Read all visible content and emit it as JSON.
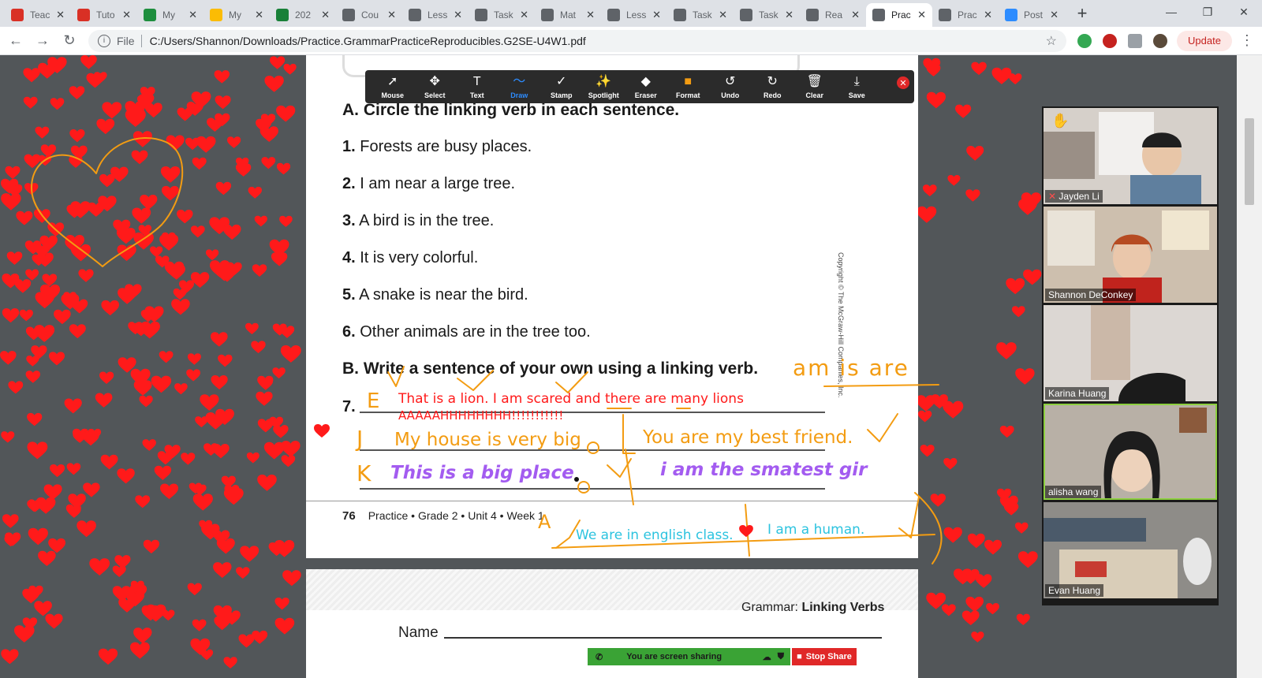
{
  "browser": {
    "tabs": [
      {
        "label": "Teac",
        "icon": "red-i-icon",
        "color": "#d93025"
      },
      {
        "label": "Tuto",
        "icon": "red-i-icon",
        "color": "#d93025"
      },
      {
        "label": "My",
        "icon": "drive-icon",
        "color": "#1e8e3e"
      },
      {
        "label": "My",
        "icon": "drive-icon",
        "color": "#fbbc04"
      },
      {
        "label": "202",
        "icon": "sheets-plus-icon",
        "color": "#188038"
      },
      {
        "label": "Cou",
        "icon": "doc-icon",
        "color": "#5f6368"
      },
      {
        "label": "Less",
        "icon": "doc-icon",
        "color": "#5f6368"
      },
      {
        "label": "Task",
        "icon": "doc-icon",
        "color": "#5f6368"
      },
      {
        "label": "Mat",
        "icon": "globe-icon",
        "color": "#5f6368"
      },
      {
        "label": "Less",
        "icon": "doc-icon",
        "color": "#5f6368"
      },
      {
        "label": "Task",
        "icon": "doc-icon",
        "color": "#5f6368"
      },
      {
        "label": "Task",
        "icon": "doc-icon",
        "color": "#5f6368"
      },
      {
        "label": "Rea",
        "icon": "globe-icon",
        "color": "#5f6368"
      },
      {
        "label": "Prac",
        "icon": "globe-icon",
        "color": "#5f6368",
        "active": true
      },
      {
        "label": "Prac",
        "icon": "globe-icon",
        "color": "#5f6368"
      },
      {
        "label": "Post",
        "icon": "zoom-icon",
        "color": "#2d8cff"
      }
    ],
    "scheme": "File",
    "url": "C:/Users/Shannon/Downloads/Practice.GrammarPracticeReproducibles.G2SE-U4W1.pdf",
    "update_label": "Update"
  },
  "worksheet": {
    "heading_a": "A. Circle the linking verb in each sentence.",
    "items": [
      {
        "num": "1.",
        "text": "Forests are busy places."
      },
      {
        "num": "2.",
        "text": "I am near a large tree."
      },
      {
        "num": "3.",
        "text": "A bird is in the tree."
      },
      {
        "num": "4.",
        "text": "It is very colorful."
      },
      {
        "num": "5.",
        "text": "A snake is near the bird."
      },
      {
        "num": "6.",
        "text": "Other animals are in the tree too."
      }
    ],
    "heading_b": "B. Write a sentence of your own using a linking verb.",
    "item7": "7.",
    "copyright": "Copyright © The McGraw-Hill Companies, Inc.",
    "footer_page": "76",
    "footer_text": "Practice • Grade 2 • Unit 4 • Week 1",
    "page2_title_prefix": "Grammar: ",
    "page2_title_bold": "Linking Verbs",
    "page2_name": "Name"
  },
  "annotations": {
    "verbs_hint": "am   is   are",
    "e_mark": "E",
    "e_text": "That is a lion. I am scared and there are many lions",
    "e_text2": "AAAAAHHHHHHHH!!!!!!!!!!!",
    "j_mark": "J",
    "j_text": "My house is very big",
    "you_text": "You are my best friend.",
    "k_mark": "K",
    "k_text": "This is a big place",
    "i_text": "i am the smatest gir",
    "a_mark": "A",
    "a_text": "We are in english class.",
    "human_text": "I am a human.",
    "colors": {
      "orange": "#f39c12",
      "red": "#ff1a1a",
      "purple": "#a35cf0",
      "cyan": "#2cc3df"
    }
  },
  "annotate_toolbar": {
    "tools": [
      {
        "label": "Mouse",
        "icon": "cursor-arrow-icon",
        "glyph": "➚"
      },
      {
        "label": "Select",
        "icon": "move-arrows-icon",
        "glyph": "✥"
      },
      {
        "label": "Text",
        "icon": "text-t-icon",
        "glyph": "T"
      },
      {
        "label": "Draw",
        "icon": "squiggle-icon",
        "glyph": "〜",
        "selected": true
      },
      {
        "label": "Stamp",
        "icon": "checkmark-icon",
        "glyph": "✓"
      },
      {
        "label": "Spotlight",
        "icon": "wand-icon",
        "glyph": "✨"
      },
      {
        "label": "Eraser",
        "icon": "eraser-icon",
        "glyph": "◆"
      },
      {
        "label": "Format",
        "icon": "format-color-icon",
        "glyph": "■"
      },
      {
        "label": "Undo",
        "icon": "undo-icon",
        "glyph": "↺"
      },
      {
        "label": "Redo",
        "icon": "redo-icon",
        "glyph": "↻"
      },
      {
        "label": "Clear",
        "icon": "trash-icon",
        "glyph": "🗑"
      },
      {
        "label": "Save",
        "icon": "save-download-icon",
        "glyph": "⤓"
      }
    ]
  },
  "participants": [
    {
      "name": "Jayden Li",
      "muted": true,
      "raised_hand": true,
      "bg": "#cfc8c2"
    },
    {
      "name": "Shannon DeConkey",
      "bg": "#c9b9a6"
    },
    {
      "name": "Karina Huang",
      "bg": "#d7d2cf"
    },
    {
      "name": "alisha wang",
      "bg": "#b5aea4",
      "active": true
    },
    {
      "name": "Evan Huang",
      "bg": "#8c8a86"
    }
  ],
  "share_banner": {
    "status": "You are screen sharing",
    "stop_label": "Stop Share"
  }
}
